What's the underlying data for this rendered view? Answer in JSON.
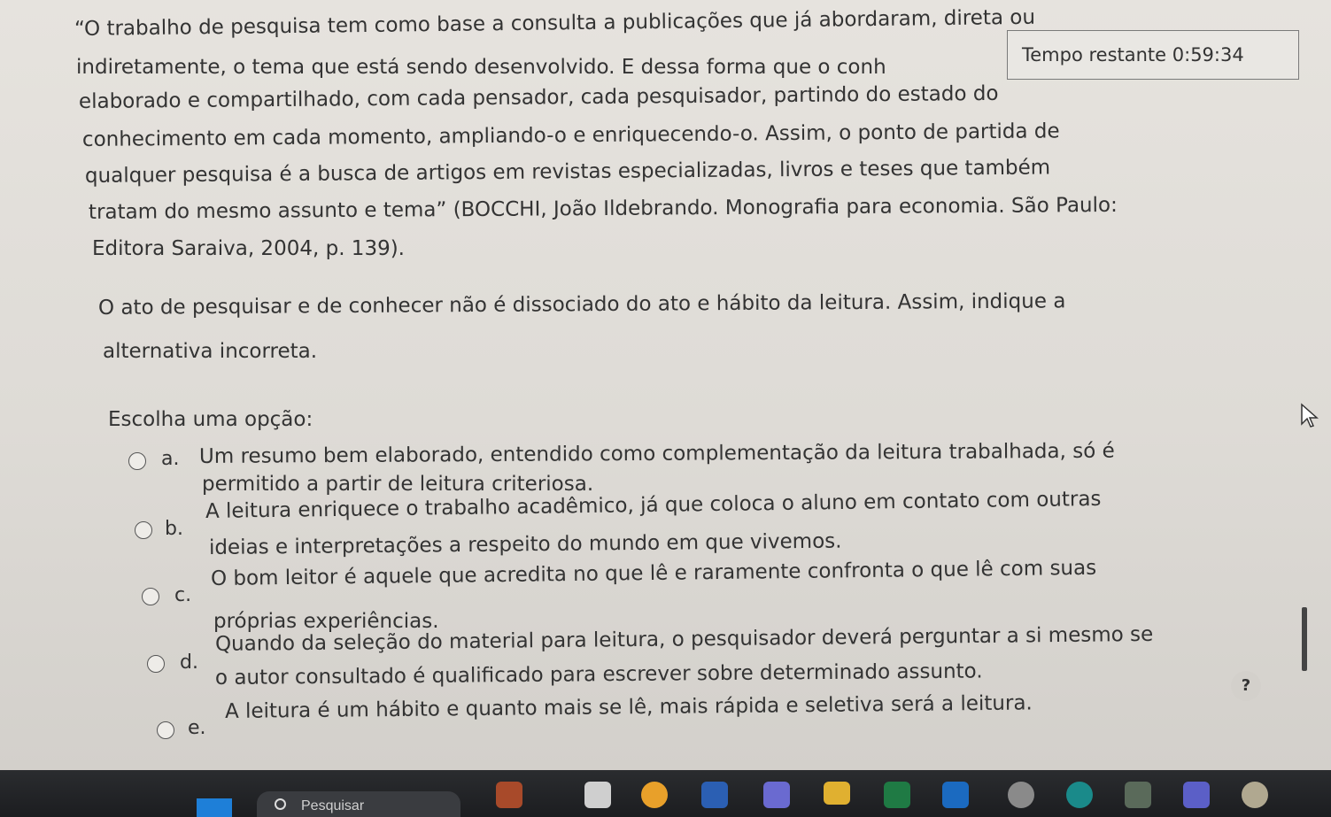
{
  "quote": {
    "lines": [
      "“O trabalho de pesquisa tem como base a consulta a publicações que já abordaram, direta ou",
      "indiretamente, o tema que está sendo desenvolvido. É dessa forma que o conh",
      "elaborado e compartilhado, com cada pensador, cada pesquisador, partindo do estado do",
      "conhecimento em cada momento, ampliando-o e enriquecendo-o. Assim, o ponto de partida de",
      "qualquer pesquisa é a busca de artigos em revistas especializadas, livros e teses que também",
      "tratam do mesmo assunto e tema” (BOCCHI, João Ildebrando. Monografia para economia. São Paulo:",
      "Editora Saraiva, 2004, p. 139)."
    ]
  },
  "timer": {
    "label": "Tempo restante 0:59:34"
  },
  "question": {
    "lines": [
      "O ato de pesquisar e de conhecer não é dissociado do ato e hábito da leitura. Assim, indique a",
      "alternativa incorreta."
    ]
  },
  "choose_label": "Escolha uma opção:",
  "options": [
    {
      "letter": "a.",
      "lines": [
        "Um resumo bem elaborado, entendido como complementação da leitura trabalhada, só é",
        "permitido a partir de leitura criteriosa."
      ]
    },
    {
      "letter": "b.",
      "lines": [
        "A leitura enriquece o trabalho acadêmico, já que coloca o aluno em contato com outras",
        "ideias e interpretações a respeito do mundo em que vivemos."
      ]
    },
    {
      "letter": "c.",
      "lines": [
        "O bom leitor é aquele que acredita no que lê e raramente confronta o que lê com suas",
        "próprias experiências."
      ]
    },
    {
      "letter": "d.",
      "lines": [
        "Quando da seleção do material para leitura, o pesquisador deverá perguntar a si mesmo se",
        "o autor consultado é qualificado para escrever sobre determinado assunto."
      ]
    },
    {
      "letter": "e.",
      "lines": [
        "A leitura é um hábito e quanto mais se lê, mais rápida e seletiva será a leitura."
      ]
    }
  ],
  "help": "?",
  "taskbar": {
    "search_label": "Pesquisar",
    "icons": [
      "start-icon",
      "weather-icon",
      "file-explorer-icon",
      "chrome-icon",
      "word-icon",
      "copilot-icon",
      "folder-icon",
      "excel-icon",
      "outlook-icon",
      "settings-icon",
      "edge-icon",
      "calculator-icon",
      "teams-icon",
      "mail-icon"
    ]
  }
}
